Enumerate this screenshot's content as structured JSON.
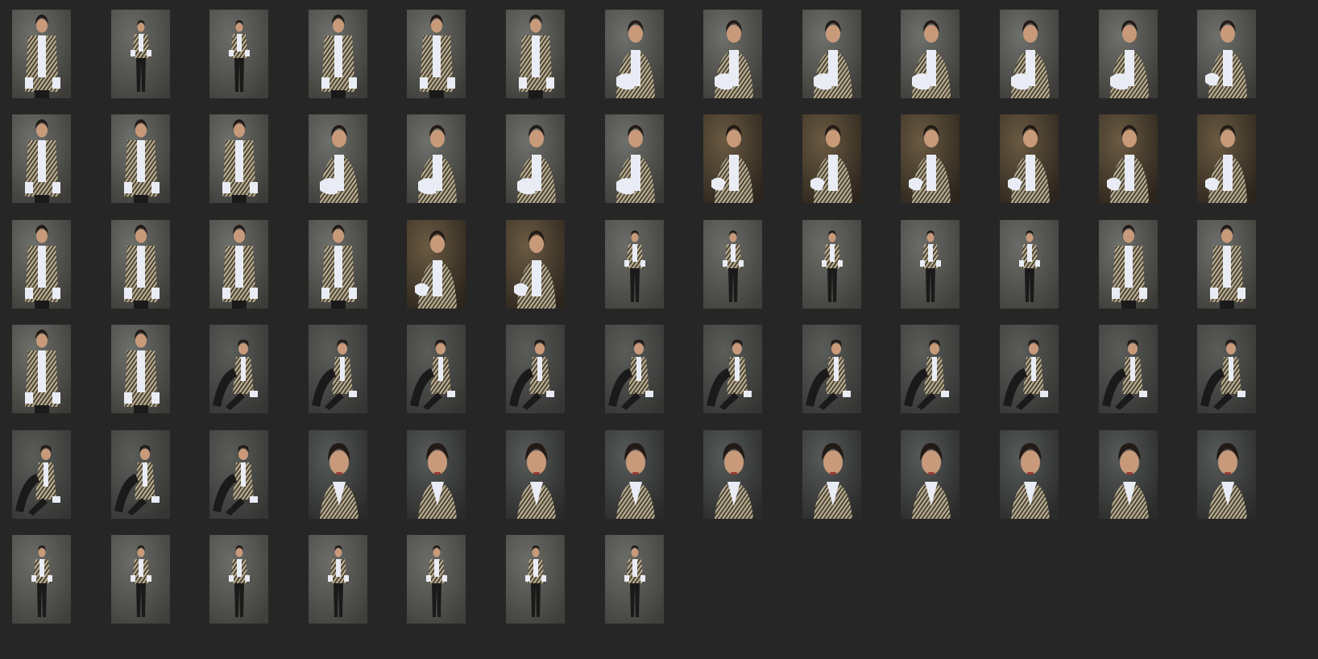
{
  "app": {
    "view": "thumbnail-grid"
  },
  "colors": {
    "background": "#262626",
    "jacket": "#b7ab8e",
    "jacket_pattern": "#3a342a",
    "shirt": "#e9ecf4",
    "pants": "#1b1a1a",
    "hair": "#221a16",
    "skin": "#c89a7a"
  },
  "rows": [
    {
      "poses": [
        "standing-closeup",
        "standing-full",
        "standing-full",
        "standing-mid",
        "standing-mid",
        "standing-mid",
        "closeup-holding-shirt",
        "closeup-holding-shirt",
        "closeup-holding-shirt",
        "closeup-holding-shirt",
        "closeup-holding-shirt",
        "closeup-holding-shirt",
        "closeup-turned"
      ]
    },
    {
      "poses": [
        "standing-mid",
        "standing-mid",
        "standing-mid",
        "closeup-holding-shirt",
        "closeup-holding-shirt",
        "closeup-holding-shirt",
        "closeup-holding-shirt",
        "closeup-warm",
        "closeup-warm",
        "closeup-warm",
        "closeup-warm",
        "closeup-warm",
        "closeup-warm"
      ]
    },
    {
      "poses": [
        "standing-mid",
        "standing-mid",
        "standing-mid",
        "standing-mid",
        "closeup-warm",
        "closeup-warm",
        "standing-full",
        "standing-full",
        "standing-full",
        "standing-full",
        "standing-full",
        "standing-mid",
        "standing-mid"
      ]
    },
    {
      "poses": [
        "standing-mid",
        "standing-mid",
        "seated",
        "seated",
        "seated",
        "seated",
        "seated",
        "seated",
        "seated",
        "seated",
        "seated",
        "seated",
        "seated"
      ]
    },
    {
      "poses": [
        "seated",
        "seated",
        "seated",
        "portrait",
        "portrait",
        "portrait",
        "portrait",
        "portrait",
        "portrait",
        "portrait",
        "portrait",
        "portrait",
        "portrait"
      ]
    },
    {
      "poses": [
        "standing-full",
        "standing-full",
        "standing-full",
        "standing-full",
        "standing-full",
        "standing-full",
        "standing-full"
      ]
    }
  ]
}
